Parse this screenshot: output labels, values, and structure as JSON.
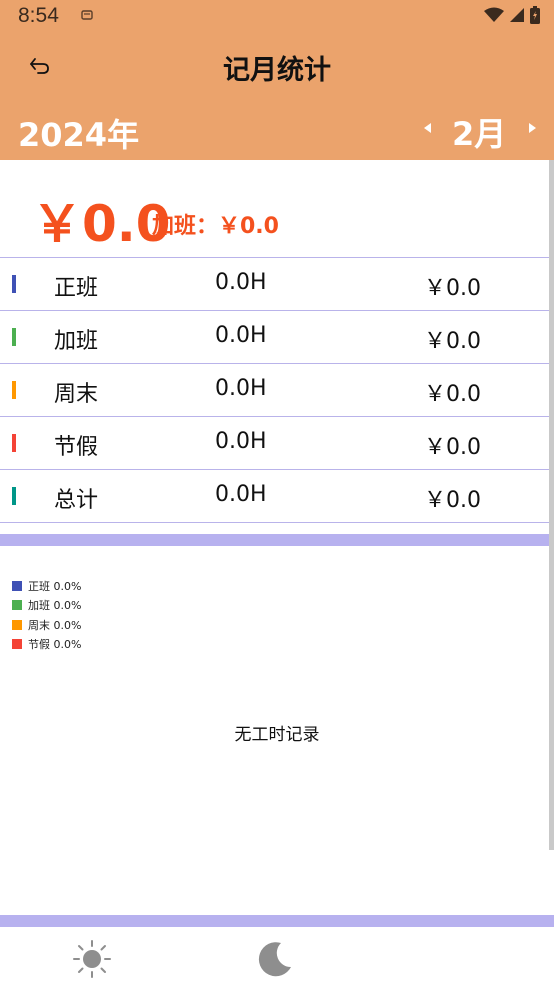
{
  "status_bar": {
    "time": "8:54"
  },
  "header": {
    "title": "记月统计"
  },
  "month_bar": {
    "year": "2024年",
    "month": "2月"
  },
  "summary": {
    "total": "￥0.0",
    "overtime": "加班：￥0.0"
  },
  "rows": [
    {
      "name": "正班",
      "hours": "0.0H",
      "money": "￥0.0",
      "color": "#3F51B5"
    },
    {
      "name": "加班",
      "hours": "0.0H",
      "money": "￥0.0",
      "color": "#4CAF50"
    },
    {
      "name": "周末",
      "hours": "0.0H",
      "money": "￥0.0",
      "color": "#FF9800"
    },
    {
      "name": "节假",
      "hours": "0.0H",
      "money": "￥0.0",
      "color": "#F44336"
    },
    {
      "name": "总计",
      "hours": "0.0H",
      "money": "￥0.0",
      "color": "#009688"
    }
  ],
  "legend": [
    {
      "label": "正班 0.0%",
      "color": "#3F51B5"
    },
    {
      "label": "加班 0.0%",
      "color": "#4CAF50"
    },
    {
      "label": "周末 0.0%",
      "color": "#FF9800"
    },
    {
      "label": "节假 0.0%",
      "color": "#F44336"
    }
  ],
  "chart_empty_text": "无工时记录",
  "bottom_nav": [
    {
      "icon": "sun-icon"
    },
    {
      "icon": "moon-icon"
    }
  ],
  "colors": {
    "primary": "#EBA36C",
    "accent": "#F4511E",
    "divider": "#B7B1EF"
  }
}
